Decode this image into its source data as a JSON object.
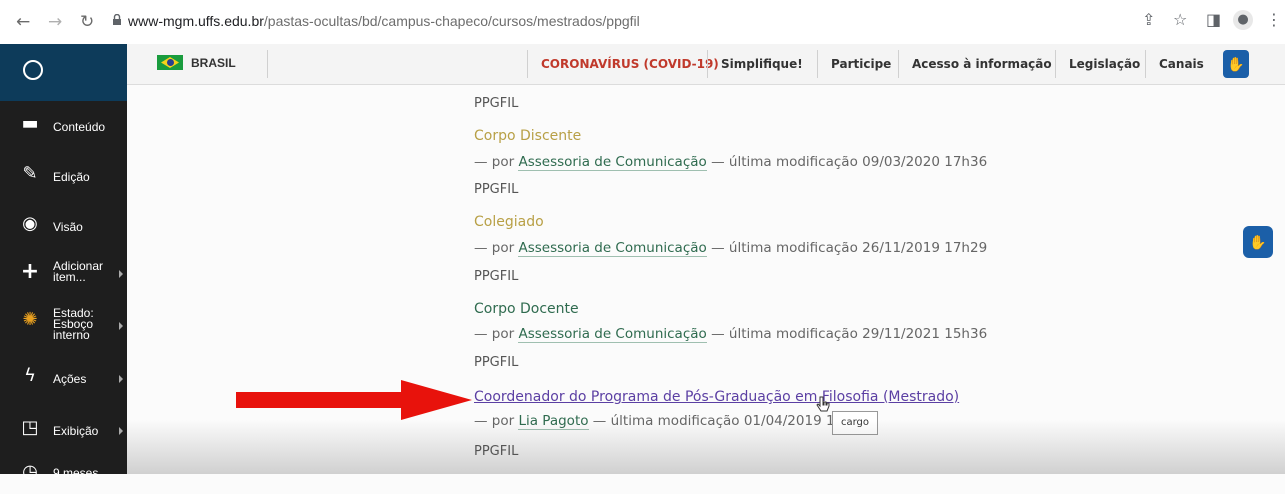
{
  "browser": {
    "url_host": "www-mgm.uffs.edu.br",
    "url_path": "/pastas-ocultas/bd/campus-chapeco/cursos/mestrados/ppgfil"
  },
  "sidebar": {
    "items": [
      {
        "label": "Conteúdo",
        "icon": "folder-icon"
      },
      {
        "label": "Edição",
        "icon": "pencil-icon"
      },
      {
        "label": "Visão",
        "icon": "eye-icon"
      },
      {
        "label_lines": [
          "Adicionar",
          "item..."
        ],
        "icon": "plus-icon"
      },
      {
        "label_lines": [
          "Estado:",
          "Esboço",
          "interno"
        ],
        "icon": "state-icon"
      },
      {
        "label": "Ações",
        "icon": "lightning-icon"
      },
      {
        "label": "Exibição",
        "icon": "display-icon"
      },
      {
        "label": "9 meses",
        "icon": "clock-icon"
      }
    ]
  },
  "gov_bar": {
    "country": "BRASIL",
    "links": [
      "CORONAVÍRUS (COVID-19)",
      "Simplifique!",
      "Participe",
      "Acesso à informação",
      "Legislação",
      "Canais"
    ]
  },
  "listing": {
    "category": "PPGFIL",
    "by": "— por",
    "modified": "— última modificação",
    "entries": [
      {
        "title": "Corpo Discente",
        "author": "Assessoria de Comunicação",
        "date": "09/03/2020 17h36",
        "category": "PPGFIL"
      },
      {
        "title": "Colegiado",
        "author": "Assessoria de Comunicação",
        "date": "26/11/2019 17h29",
        "category": "PPGFIL"
      },
      {
        "title": "Corpo Docente",
        "author": "Assessoria de Comunicação",
        "date": "29/11/2021 15h36",
        "category": "PPGFIL"
      },
      {
        "title": "Coordenador do Programa de Pós-Graduação em Filosofia (Mestrado)",
        "author": "Lia Pagoto",
        "date": "01/04/2019 1",
        "category": "PPGFIL"
      }
    ]
  },
  "tooltip": "cargo",
  "colors": {
    "arrow": "#e8120c",
    "sidebar": "#1e1e1e",
    "covid": "#c0392b"
  }
}
